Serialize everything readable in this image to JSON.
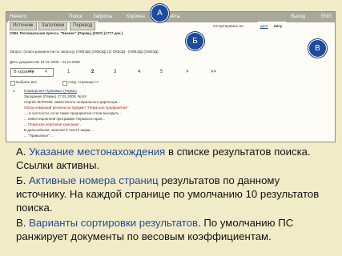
{
  "screenshot": {
    "top_tabs": [
      "Начало",
      "Поиск",
      "Запросы",
      "Корзина",
      "Отчёты",
      "Выход"
    ],
    "right_tab": "ENG",
    "sub_tabs": [
      "Источник",
      "Заголовки",
      "Перевод"
    ],
    "sort_options": [
      "Отсортировать по:",
      "дате",
      "весу"
    ],
    "results_title": "СМИ. Региональная пресса. \"Бизнес\" (Пермь) (2007) (1777 док.)",
    "query_line": "Запрос: (поиск документов по запросу) (ОКВЭД) (ОКВЭД) (2) ОКВЭД - (ОКВЭД) (ОКВЭД)",
    "dates_line": "Даты документов: 01.01.2005 - 31.12.2006",
    "cart_button": "В корзину",
    "pages": [
      "<<",
      "<",
      "1",
      "2",
      "3",
      "4",
      "5",
      ">",
      ">>"
    ],
    "select_all": "выбрать все",
    "select_page": "след. страница >>",
    "result": {
      "title": "Коммерсант-Прикамье (Пермь)",
      "meta": "Заседания (Пермь) 17.01.2005; № 54",
      "line1": "Сергей ЖАРКОВ, заместитель генерального директора...",
      "line2": "Обзор компаний региона на предмет \"Пермское предприятие\"",
      "line3": "..., в частности, если такие предприятия стали выходить...",
      "line4": "... инвестиционной программе Пермского края...",
      "line5": "... Пермская нефтяная компания ...",
      "line6": "В дальнейшем, наличие в тексте акции ...",
      "line7": "... \"Приволжье\" ..."
    }
  },
  "callouts": [
    "А",
    "Б",
    "В"
  ],
  "legend": [
    {
      "prefix": "А. ",
      "highlight": "Указание местонахождения",
      "text": " в списке результатов поиска. Ссылки активны."
    },
    {
      "prefix": "Б. ",
      "highlight": "Активные номера страниц",
      "text": " результатов по данному источнику. На каждой странице по умолчанию 10 результатов поиска."
    },
    {
      "prefix": "В. ",
      "highlight": "Варианты сортировки результатов",
      "text": ". По умолчанию ПС ранжирует документы по весовым коэффициентам."
    }
  ]
}
